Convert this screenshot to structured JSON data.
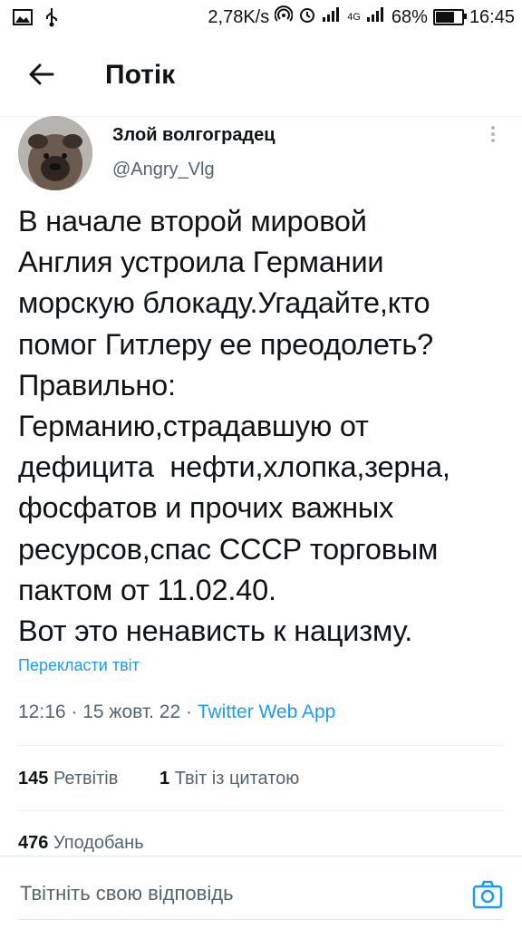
{
  "status_bar": {
    "net_speed": "2,78K/s",
    "network_type": "4G",
    "battery_percent": "68%",
    "time": "16:45",
    "icons": [
      "image-icon",
      "usb-icon",
      "hotspot-icon",
      "alarm-icon",
      "signal-icon",
      "signal-icon",
      "battery-icon"
    ]
  },
  "header": {
    "back_icon": "arrow-left-icon",
    "title": "Потік"
  },
  "tweet": {
    "author_name": "Злой волгоградец",
    "author_handle": "@Angry_Vlg",
    "text": "В начале второй мировой\nАнглия устроила Германии\nморскую блокаду.Угадайте,кто\nпомог Гитлеру ее преодолеть?\nПравильно:\nГерманию,страдавшую от\nдефицита  нефти,хлопка,зерна,\nфосфатов и прочих важных\nресурсов,спас СССР торговым\nпактом от 11.02.40.\nВот это ненависть к нацизму.",
    "translate_label": "Перекласти твіт",
    "time": "12:16",
    "date": "15 жовт. 22",
    "source": "Twitter Web App",
    "separator": " · "
  },
  "stats": {
    "retweets_count": "145",
    "retweets_label": "Ретвітів",
    "quotes_count": "1",
    "quotes_label": "Твіт із цитатою",
    "likes_count": "476",
    "likes_label": "Уподобань"
  },
  "reply": {
    "placeholder": "Твітніть свою відповідь",
    "camera_icon": "camera-icon"
  },
  "colors": {
    "accent": "#1d9bf0",
    "text_primary": "#0f1419",
    "text_secondary": "#536471"
  }
}
